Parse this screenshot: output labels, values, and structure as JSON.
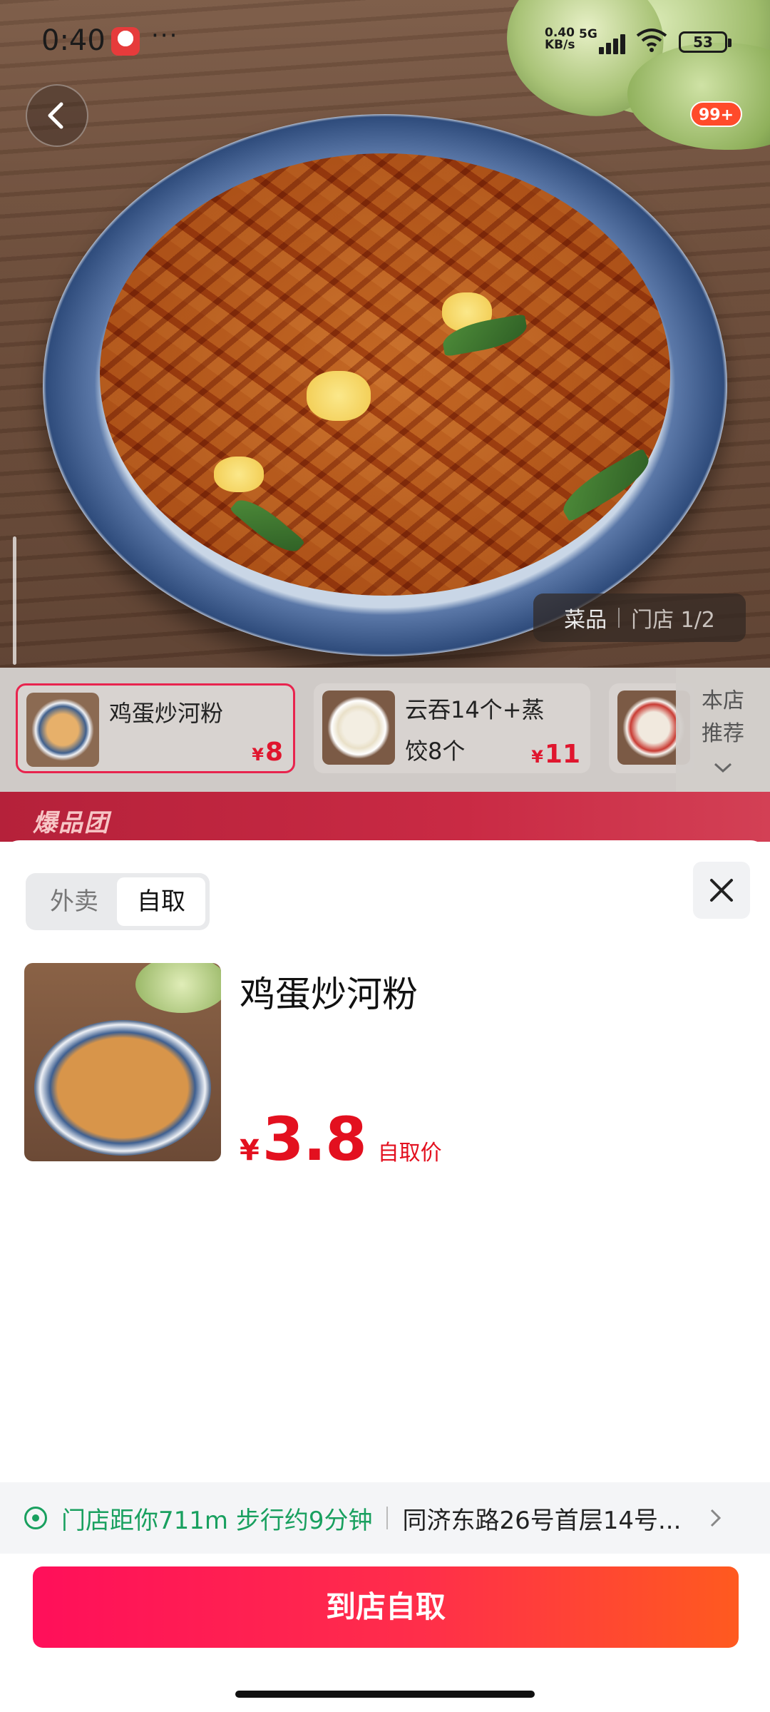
{
  "status_bar": {
    "time": "0:40",
    "dots": "···",
    "net_speed": "0.40",
    "net_unit": "KB/s",
    "net_type": "5G",
    "battery": "53"
  },
  "hero": {
    "unread_badge": "99+",
    "pager_tab": "菜品",
    "pager_other": "门店 1/2"
  },
  "strip": {
    "items": [
      {
        "name": "鸡蛋炒河粉",
        "currency": "¥",
        "price": "8"
      },
      {
        "name": "云吞14个+蒸饺8个",
        "currency": "¥",
        "price": "11"
      }
    ],
    "store_recommend": "本店推荐"
  },
  "promo": {
    "logo_text": "爆品团"
  },
  "sheet": {
    "tabs": [
      "外卖",
      "自取"
    ],
    "selected_tab": "自取",
    "dish_title": "鸡蛋炒河粉",
    "currency": "¥",
    "price": "3.8",
    "price_tag": "自取价",
    "distance": "门店距你711m 步行约9分钟",
    "address": "同济东路26号首层14号...",
    "cta": "到店自取"
  },
  "colors": {
    "accent_red": "#e3101f",
    "cta_start": "#ff0f5a",
    "cta_end": "#ff5a1f",
    "location_green": "#19a05f"
  }
}
